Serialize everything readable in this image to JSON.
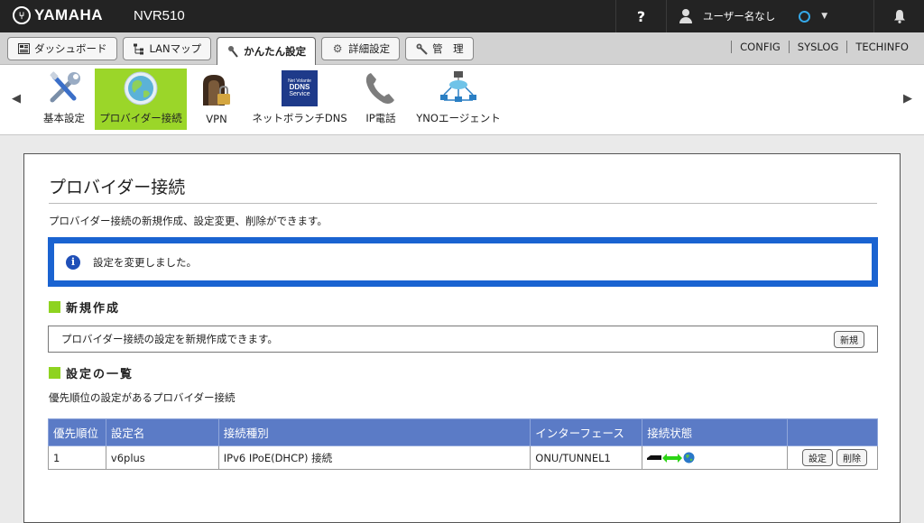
{
  "header": {
    "brand": "YAMAHA",
    "model": "NVR510",
    "help_label": "?",
    "user_label": "ユーザー名なし"
  },
  "tabs": [
    {
      "label": "ダッシュボード",
      "icon": "dashboard-icon"
    },
    {
      "label": "LANマップ",
      "icon": "lan-map-icon"
    },
    {
      "label": "かんたん設定",
      "icon": "wand-icon"
    },
    {
      "label": "詳細設定",
      "icon": "gear-icon"
    },
    {
      "label": "管　理",
      "icon": "wrench-icon"
    }
  ],
  "links": [
    "CONFIG",
    "SYSLOG",
    "TECHINFO"
  ],
  "icon_menu": [
    {
      "label": "基本設定",
      "icon": "tools-icon"
    },
    {
      "label": "プロバイダー接続",
      "icon": "globe-icon"
    },
    {
      "label": "VPN",
      "icon": "lock-icon"
    },
    {
      "label": "ネットボランチDNS",
      "icon": "ddns-icon"
    },
    {
      "label": "IP電話",
      "icon": "phone-icon"
    },
    {
      "label": "YNOエージェント",
      "icon": "network-icon"
    }
  ],
  "ddns_icon_text": [
    "Net Volante",
    "DDNS",
    "Service"
  ],
  "page": {
    "title": "プロバイダー接続",
    "description": "プロバイダー接続の新規作成、設定変更、削除ができます。",
    "notice": "設定を変更しました。",
    "new_section_title": "新規作成",
    "new_section_desc": "プロバイダー接続の設定を新規作成できます。",
    "new_button": "新規",
    "list_section_title": "設定の一覧",
    "list_desc": "優先順位の設定があるプロバイダー接続"
  },
  "table": {
    "headers": [
      "優先順位",
      "設定名",
      "接続種別",
      "インターフェース",
      "接続状態",
      ""
    ],
    "rows": [
      {
        "priority": "1",
        "name": "v6plus",
        "type": "IPv6 IPoE(DHCP) 接続",
        "interface": "ONU/TUNNEL1",
        "status": "connected",
        "edit_label": "設定",
        "delete_label": "削除"
      }
    ]
  },
  "colors": {
    "accent_green": "#9bd629",
    "notice_blue": "#1a63d1",
    "table_header": "#5b7bc6",
    "topbar": "#232323"
  }
}
